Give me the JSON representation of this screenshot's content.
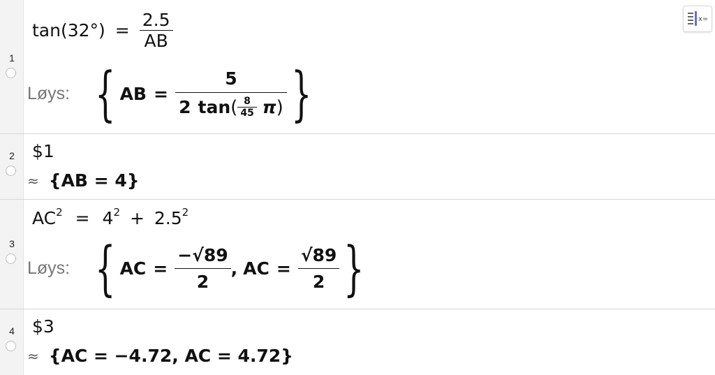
{
  "cells": [
    {
      "number": "1",
      "input": {
        "lhs": "tan(32°)",
        "eq": "=",
        "num": "2.5",
        "den": "AB"
      },
      "output": {
        "prefix": "Løys:",
        "var": "AB",
        "eq": "=",
        "num": "5",
        "den_coef": "2",
        "den_func": "tan",
        "den_frac_num": "8",
        "den_frac_den": "45",
        "den_pi": "π"
      }
    },
    {
      "number": "2",
      "input": {
        "text": "$1"
      },
      "output": {
        "symbol": "≈",
        "text": "{AB = 4}"
      }
    },
    {
      "number": "3",
      "input": {
        "base": "AC",
        "exp": "2",
        "eq": "=",
        "a": "4",
        "a_exp": "2",
        "plus": "+",
        "b": "2.5",
        "b_exp": "2"
      },
      "output": {
        "prefix": "Løys:",
        "var1": "AC",
        "eq": "=",
        "num1": "−√89",
        "den1": "2",
        "sep": ",",
        "var2": "AC",
        "num2": "√89",
        "den2": "2"
      }
    },
    {
      "number": "4",
      "input": {
        "text": "$3"
      },
      "output": {
        "symbol": "≈",
        "text": "{AC = −4.72, AC = 4.72}"
      }
    }
  ],
  "toolbar": {
    "icon": "x=",
    "icon_name": "algebra-input-icon"
  }
}
